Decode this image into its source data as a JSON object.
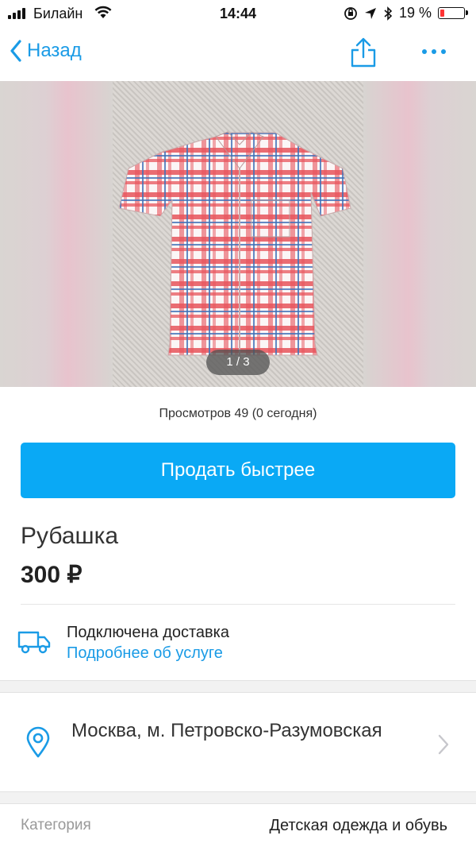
{
  "status_bar": {
    "carrier": "Билайн",
    "time": "14:44",
    "battery_percent": "19 %",
    "battery_level": 0.19,
    "signal_bars": 4
  },
  "nav": {
    "back_label": "Назад",
    "accent_color": "#1a9be6"
  },
  "gallery": {
    "counter": "1 / 3"
  },
  "views_text": "Просмотров 49 (0 сегодня)",
  "sell_button": {
    "label": "Продать быстрее",
    "color": "#0aa9f5"
  },
  "listing": {
    "title": "Рубашка",
    "price": "300 ₽"
  },
  "delivery": {
    "title": "Подключена доставка",
    "link": "Подробнее об услуге"
  },
  "location": {
    "text": "Москва, м. Петровско-Разумовская"
  },
  "category": {
    "label": "Категория",
    "value": "Детская одежда и обувь"
  }
}
